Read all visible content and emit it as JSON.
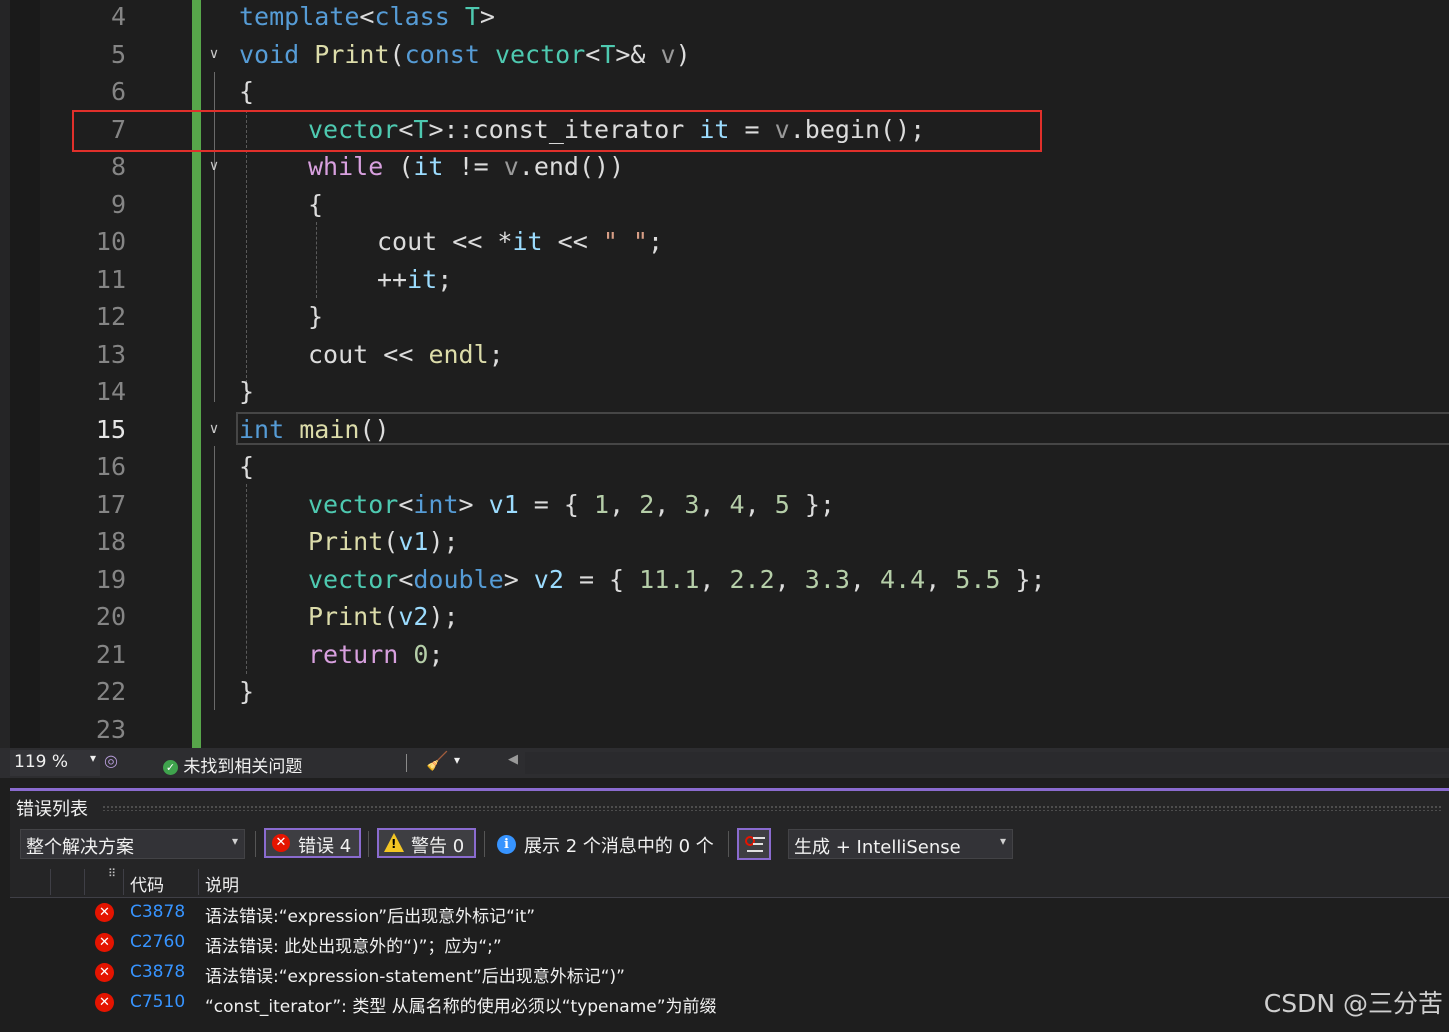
{
  "editor": {
    "line_numbers": [
      "4",
      "5",
      "6",
      "7",
      "8",
      "9",
      "10",
      "11",
      "12",
      "13",
      "14",
      "15",
      "16",
      "17",
      "18",
      "19",
      "20",
      "21",
      "22",
      "23"
    ],
    "current_line": "15",
    "code": {
      "l4": [
        "template",
        "<",
        "class",
        " ",
        "T",
        ">"
      ],
      "l5": [
        "void",
        " ",
        "Print",
        "(",
        "const",
        " ",
        "vector",
        "<",
        "T",
        ">&",
        " ",
        "v",
        ")"
      ],
      "l6": [
        "{"
      ],
      "l7": [
        "vector",
        "<",
        "T",
        ">::",
        "const_iterator",
        " ",
        "it",
        " = ",
        "v",
        ".",
        "begin",
        "();"
      ],
      "l8": [
        "while",
        " (",
        "it",
        " != ",
        "v",
        ".",
        "end",
        "())"
      ],
      "l9": [
        "{"
      ],
      "l10": [
        "cout",
        " << *",
        "it",
        " << ",
        "\" \"",
        ";"
      ],
      "l11": [
        "++",
        "it",
        ";"
      ],
      "l12": [
        "}"
      ],
      "l13": [
        "cout",
        " << ",
        "endl",
        ";"
      ],
      "l14": [
        "}"
      ],
      "l15": [
        "int",
        " ",
        "main",
        "()"
      ],
      "l16": [
        "{"
      ],
      "l17": [
        "vector",
        "<",
        "int",
        "> ",
        "v1",
        " = { ",
        "1",
        ", ",
        "2",
        ", ",
        "3",
        ", ",
        "4",
        ", ",
        "5",
        " };"
      ],
      "l18": [
        "Print",
        "(",
        "v1",
        ");"
      ],
      "l19": [
        "vector",
        "<",
        "double",
        "> ",
        "v2",
        " = { ",
        "11.1",
        ", ",
        "2.2",
        ", ",
        "3.3",
        ", ",
        "4.4",
        ", ",
        "5.5",
        " };"
      ],
      "l20": [
        "Print",
        "(",
        "v2",
        ");"
      ],
      "l21": [
        "return",
        " ",
        "0",
        ";"
      ],
      "l22": [
        "}"
      ]
    },
    "fold_glyph": "∨"
  },
  "status_bar": {
    "zoom": "119 %",
    "zoom_dropdown": "▾",
    "health_text": "未找到相关问题",
    "health_check": "✓",
    "brush_dropdown": "▾",
    "scroll_left": "◀"
  },
  "error_list": {
    "title": "错误列表",
    "scope": "整个解决方案",
    "scope_dropdown": "▾",
    "errors_label": "错误 4",
    "warnings_label": "警告 0",
    "messages_label": "展示 2 个消息中的 0 个",
    "build_filter": "生成 + IntelliSense",
    "build_dropdown": "▾",
    "columns": {
      "code": "代码",
      "description": "说明"
    },
    "rows": [
      {
        "code": "C3878",
        "description": "语法错误:“expression”后出现意外标记“it”"
      },
      {
        "code": "C2760",
        "description": "语法错误: 此处出现意外的“)”；应为“;”"
      },
      {
        "code": "C3878",
        "description": "语法错误:“expression-statement”后出现意外标记“)”"
      },
      {
        "code": "C7510",
        "description": "“const_iterator”: 类型 从属名称的使用必须以“typename”为前缀"
      }
    ]
  },
  "watermark": "CSDN @三分苦",
  "colors": {
    "keyword": "#569cd6",
    "type": "#4ec9b0",
    "function": "#dcdcaa",
    "template_param": "#b8d7a3",
    "variable": "#9cdcfe",
    "control": "#d8a0df",
    "number": "#b5cea8",
    "string": "#d69d85",
    "change_bar": "#57a64a",
    "highlight_box": "#e0302b",
    "panel_accent": "#8a6bcf",
    "error": "#e51400"
  }
}
